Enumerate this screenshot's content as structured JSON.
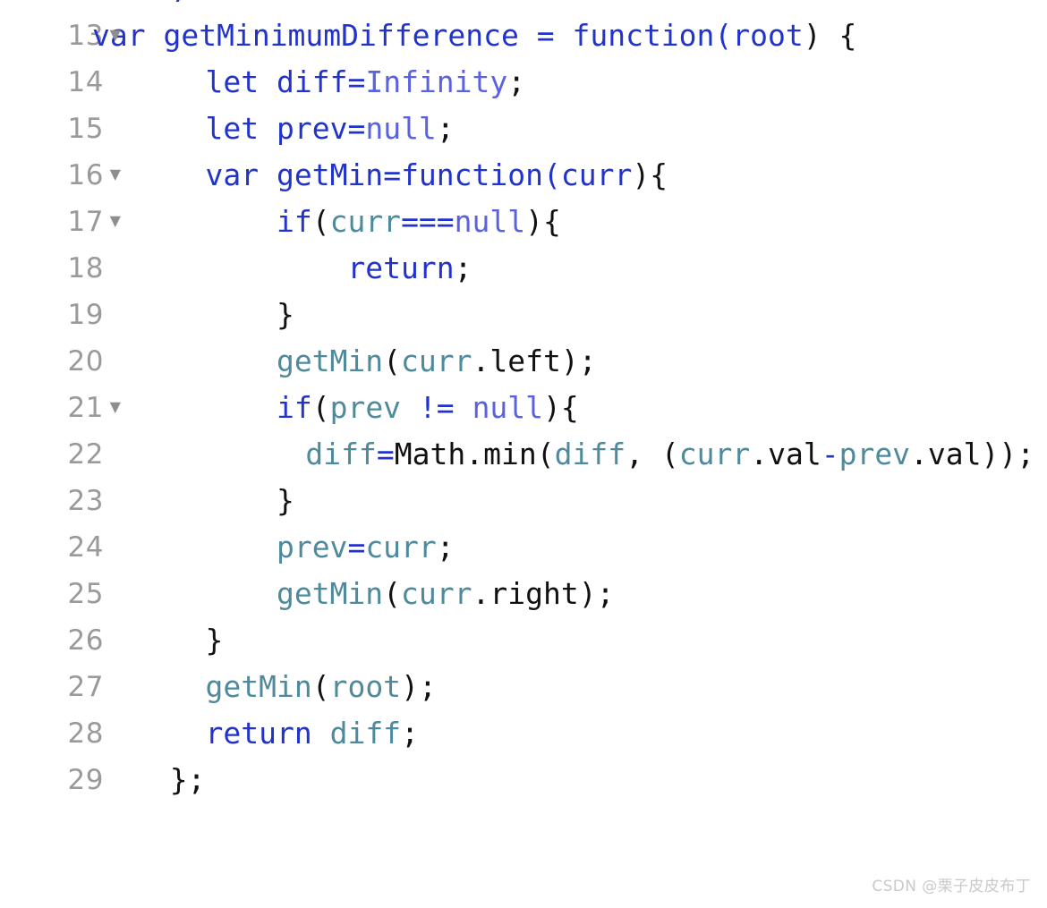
{
  "editor": {
    "language": "javascript",
    "background_color": "#ffffff",
    "gutter_color": "#9a9a9a",
    "fold_marker": "▼",
    "colors": {
      "keyword": "#2233cc",
      "literal": "#5b62e0",
      "identifier": "#4f8a9c",
      "punctuation": "#111111",
      "operator": "#2233cc",
      "line_number": "#9a9a9a",
      "watermark": "#c9c9c9"
    },
    "clipped_top_glyph": "/",
    "lines": [
      {
        "number": "13",
        "foldable": true,
        "wrapped": true,
        "tokens": [
          {
            "t": "var ",
            "c": "kw"
          },
          {
            "t": "getMinimumDifference ",
            "c": "kw"
          },
          {
            "t": "= ",
            "c": "op"
          },
          {
            "t": "function",
            "c": "kw"
          },
          {
            "t": "(",
            "c": "kw"
          },
          {
            "t": "root",
            "c": "kw"
          },
          {
            "t": ")",
            "c": "plain"
          },
          {
            "t": " ",
            "c": "plain"
          },
          {
            "t": "{",
            "c": "plain"
          }
        ],
        "text": "var getMinimumDifference = function(root) {"
      },
      {
        "number": "14",
        "foldable": false,
        "wrapped": false,
        "indent": 4,
        "tokens": [
          {
            "t": "let ",
            "c": "kw"
          },
          {
            "t": "diff",
            "c": "kw"
          },
          {
            "t": "=",
            "c": "op"
          },
          {
            "t": "Infinity",
            "c": "lit"
          },
          {
            "t": ";",
            "c": "plain"
          }
        ],
        "text": "    let diff=Infinity;"
      },
      {
        "number": "15",
        "foldable": false,
        "wrapped": false,
        "indent": 4,
        "tokens": [
          {
            "t": "let ",
            "c": "kw"
          },
          {
            "t": "prev",
            "c": "kw"
          },
          {
            "t": "=",
            "c": "op"
          },
          {
            "t": "null",
            "c": "lit"
          },
          {
            "t": ";",
            "c": "plain"
          }
        ],
        "text": "    let prev=null;"
      },
      {
        "number": "16",
        "foldable": true,
        "wrapped": false,
        "indent": 4,
        "tokens": [
          {
            "t": "var ",
            "c": "kw"
          },
          {
            "t": "getMin",
            "c": "kw"
          },
          {
            "t": "=",
            "c": "op"
          },
          {
            "t": "function",
            "c": "kw"
          },
          {
            "t": "(",
            "c": "kw"
          },
          {
            "t": "curr",
            "c": "kw"
          },
          {
            "t": ")",
            "c": "plain"
          },
          {
            "t": "{",
            "c": "plain"
          }
        ],
        "text": "    var getMin=function(curr){"
      },
      {
        "number": "17",
        "foldable": true,
        "wrapped": false,
        "indent": 8,
        "tokens": [
          {
            "t": "if",
            "c": "kw"
          },
          {
            "t": "(",
            "c": "plain"
          },
          {
            "t": "curr",
            "c": "ident"
          },
          {
            "t": "===",
            "c": "op"
          },
          {
            "t": "null",
            "c": "lit"
          },
          {
            "t": ")",
            "c": "plain"
          },
          {
            "t": "{",
            "c": "plain"
          }
        ],
        "text": "        if(curr===null){"
      },
      {
        "number": "18",
        "foldable": false,
        "wrapped": false,
        "indent": 12,
        "tokens": [
          {
            "t": "return",
            "c": "kw"
          },
          {
            "t": ";",
            "c": "plain"
          }
        ],
        "text": "            return;"
      },
      {
        "number": "19",
        "foldable": false,
        "wrapped": false,
        "indent": 8,
        "tokens": [
          {
            "t": "}",
            "c": "plain"
          }
        ],
        "text": "        }"
      },
      {
        "number": "20",
        "foldable": false,
        "wrapped": false,
        "indent": 8,
        "tokens": [
          {
            "t": "getMin",
            "c": "ident"
          },
          {
            "t": "(",
            "c": "plain"
          },
          {
            "t": "curr",
            "c": "ident"
          },
          {
            "t": ".left",
            "c": "plain"
          },
          {
            "t": ")",
            "c": "plain"
          },
          {
            "t": ";",
            "c": "plain"
          }
        ],
        "text": "        getMin(curr.left);"
      },
      {
        "number": "21",
        "foldable": true,
        "wrapped": false,
        "indent": 8,
        "tokens": [
          {
            "t": "if",
            "c": "kw"
          },
          {
            "t": "(",
            "c": "plain"
          },
          {
            "t": "prev",
            "c": "ident"
          },
          {
            "t": " ",
            "c": "plain"
          },
          {
            "t": "!=",
            "c": "op"
          },
          {
            "t": " ",
            "c": "plain"
          },
          {
            "t": "null",
            "c": "lit"
          },
          {
            "t": ")",
            "c": "plain"
          },
          {
            "t": "{",
            "c": "plain"
          }
        ],
        "text": "        if(prev != null){"
      },
      {
        "number": "22",
        "foldable": false,
        "wrapped": true,
        "indent": 12,
        "tokens": [
          {
            "t": "diff",
            "c": "ident"
          },
          {
            "t": "=",
            "c": "op"
          },
          {
            "t": "Math",
            "c": "plain"
          },
          {
            "t": ".min",
            "c": "plain"
          },
          {
            "t": "(",
            "c": "plain"
          },
          {
            "t": "diff",
            "c": "ident"
          },
          {
            "t": ", ",
            "c": "plain"
          },
          {
            "t": "(",
            "c": "plain"
          },
          {
            "t": "curr",
            "c": "ident"
          },
          {
            "t": ".val",
            "c": "plain"
          },
          {
            "t": "-",
            "c": "op"
          },
          {
            "t": "prev",
            "c": "ident"
          },
          {
            "t": ".val",
            "c": "plain"
          },
          {
            "t": ")",
            "c": "plain"
          },
          {
            "t": ")",
            "c": "plain"
          },
          {
            "t": ";",
            "c": "plain"
          }
        ],
        "text": "            diff=Math.min(diff, (curr.val-prev.val));"
      },
      {
        "number": "23",
        "foldable": false,
        "wrapped": false,
        "indent": 8,
        "tokens": [
          {
            "t": "}",
            "c": "plain"
          }
        ],
        "text": "        }"
      },
      {
        "number": "24",
        "foldable": false,
        "wrapped": false,
        "indent": 8,
        "tokens": [
          {
            "t": "prev",
            "c": "ident"
          },
          {
            "t": "=",
            "c": "op"
          },
          {
            "t": "curr",
            "c": "ident"
          },
          {
            "t": ";",
            "c": "plain"
          }
        ],
        "text": "        prev=curr;"
      },
      {
        "number": "25",
        "foldable": false,
        "wrapped": false,
        "indent": 8,
        "tokens": [
          {
            "t": "getMin",
            "c": "ident"
          },
          {
            "t": "(",
            "c": "plain"
          },
          {
            "t": "curr",
            "c": "ident"
          },
          {
            "t": ".right",
            "c": "plain"
          },
          {
            "t": ")",
            "c": "plain"
          },
          {
            "t": ";",
            "c": "plain"
          }
        ],
        "text": "        getMin(curr.right);"
      },
      {
        "number": "26",
        "foldable": false,
        "wrapped": false,
        "indent": 4,
        "tokens": [
          {
            "t": "}",
            "c": "plain"
          }
        ],
        "text": "    }"
      },
      {
        "number": "27",
        "foldable": false,
        "wrapped": false,
        "indent": 4,
        "tokens": [
          {
            "t": "getMin",
            "c": "ident"
          },
          {
            "t": "(",
            "c": "plain"
          },
          {
            "t": "root",
            "c": "ident"
          },
          {
            "t": ")",
            "c": "plain"
          },
          {
            "t": ";",
            "c": "plain"
          }
        ],
        "text": "    getMin(root);"
      },
      {
        "number": "28",
        "foldable": false,
        "wrapped": false,
        "indent": 4,
        "tokens": [
          {
            "t": "return",
            "c": "kw"
          },
          {
            "t": " ",
            "c": "plain"
          },
          {
            "t": "diff",
            "c": "ident"
          },
          {
            "t": ";",
            "c": "plain"
          }
        ],
        "text": "    return diff;"
      },
      {
        "number": "29",
        "foldable": false,
        "wrapped": false,
        "indent": 2,
        "tokens": [
          {
            "t": "}",
            "c": "plain"
          },
          {
            "t": ";",
            "c": "plain"
          }
        ],
        "text": "  };"
      }
    ]
  },
  "watermark": {
    "text": "CSDN @栗子皮皮布丁"
  }
}
